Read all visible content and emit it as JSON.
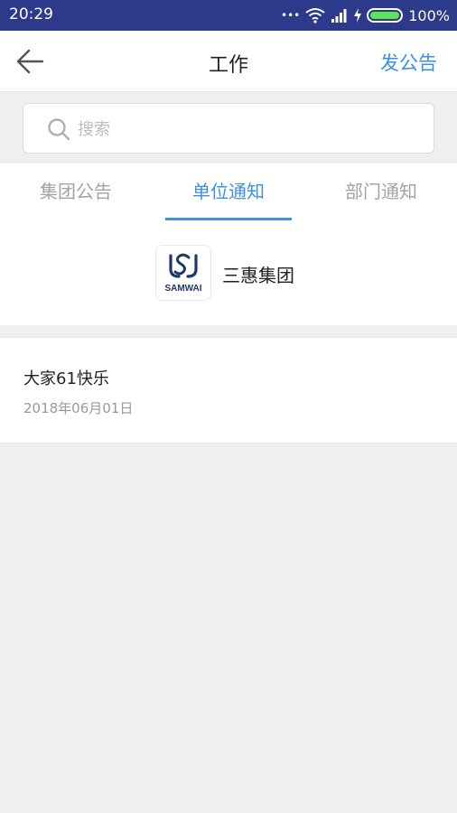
{
  "status_bar": {
    "time": "20:29",
    "dots": "•••",
    "battery": "100%",
    "battery_level": 1.0
  },
  "header": {
    "title": "工作",
    "action": "发公告"
  },
  "search": {
    "placeholder": "搜索"
  },
  "tabs": [
    {
      "label": "集团公告",
      "active": false
    },
    {
      "label": "单位通知",
      "active": true
    },
    {
      "label": "部门通知",
      "active": false
    }
  ],
  "org": {
    "logo_text": "SAMWAI",
    "name": "三惠集团"
  },
  "notices": [
    {
      "title": "大家61快乐",
      "date": "2018年06月01日"
    }
  ],
  "colors": {
    "status_bar": "#2d3a8c",
    "accent": "#3d8fe0",
    "background": "#efefef",
    "battery": "#5ee35a"
  }
}
